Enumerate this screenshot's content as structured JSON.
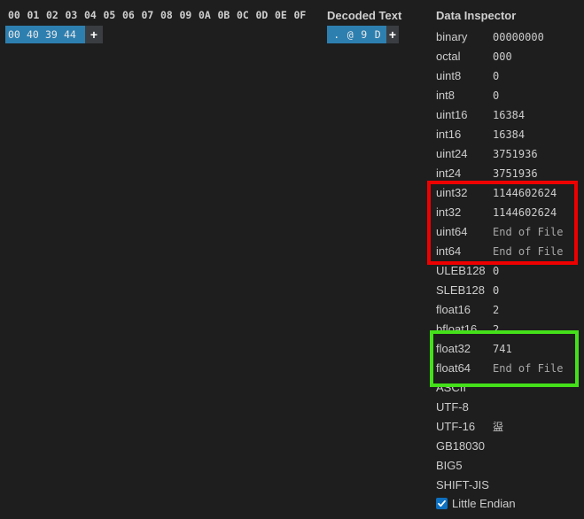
{
  "hex_header": [
    "00",
    "01",
    "02",
    "03",
    "04",
    "05",
    "06",
    "07",
    "08",
    "09",
    "0A",
    "0B",
    "0C",
    "0D",
    "0E",
    "0F"
  ],
  "hex_bytes": [
    "00",
    "40",
    "39",
    "44"
  ],
  "add_label": "+",
  "decoded": {
    "title": "Decoded Text",
    "chars": [
      ".",
      "@",
      "9",
      "D"
    ]
  },
  "inspector": {
    "title": "Data Inspector",
    "rows": [
      {
        "label": "binary",
        "value": "00000000"
      },
      {
        "label": "octal",
        "value": "000"
      },
      {
        "label": "uint8",
        "value": "0"
      },
      {
        "label": "int8",
        "value": "0"
      },
      {
        "label": "uint16",
        "value": "16384"
      },
      {
        "label": "int16",
        "value": "16384"
      },
      {
        "label": "uint24",
        "value": "3751936"
      },
      {
        "label": "int24",
        "value": "3751936"
      },
      {
        "label": "uint32",
        "value": "1144602624"
      },
      {
        "label": "int32",
        "value": "1144602624"
      },
      {
        "label": "uint64",
        "value": "End of File"
      },
      {
        "label": "int64",
        "value": "End of File"
      },
      {
        "label": "ULEB128",
        "value": "0"
      },
      {
        "label": "SLEB128",
        "value": "0"
      },
      {
        "label": "float16",
        "value": "2"
      },
      {
        "label": "bfloat16",
        "value": "2"
      },
      {
        "label": "float32",
        "value": "741"
      },
      {
        "label": "float64",
        "value": "End of File"
      },
      {
        "label": "ASCII",
        "value": ""
      },
      {
        "label": "UTF-8",
        "value": ""
      },
      {
        "label": "UTF-16",
        "value": "䀀"
      },
      {
        "label": "GB18030",
        "value": ""
      },
      {
        "label": "BIG5",
        "value": ""
      },
      {
        "label": "SHIFT-JIS",
        "value": ""
      }
    ],
    "little_endian": {
      "label": "Little Endian",
      "checked": true
    }
  },
  "highlights": {
    "red_color": "#ee0000",
    "green_color": "#44e01a"
  }
}
